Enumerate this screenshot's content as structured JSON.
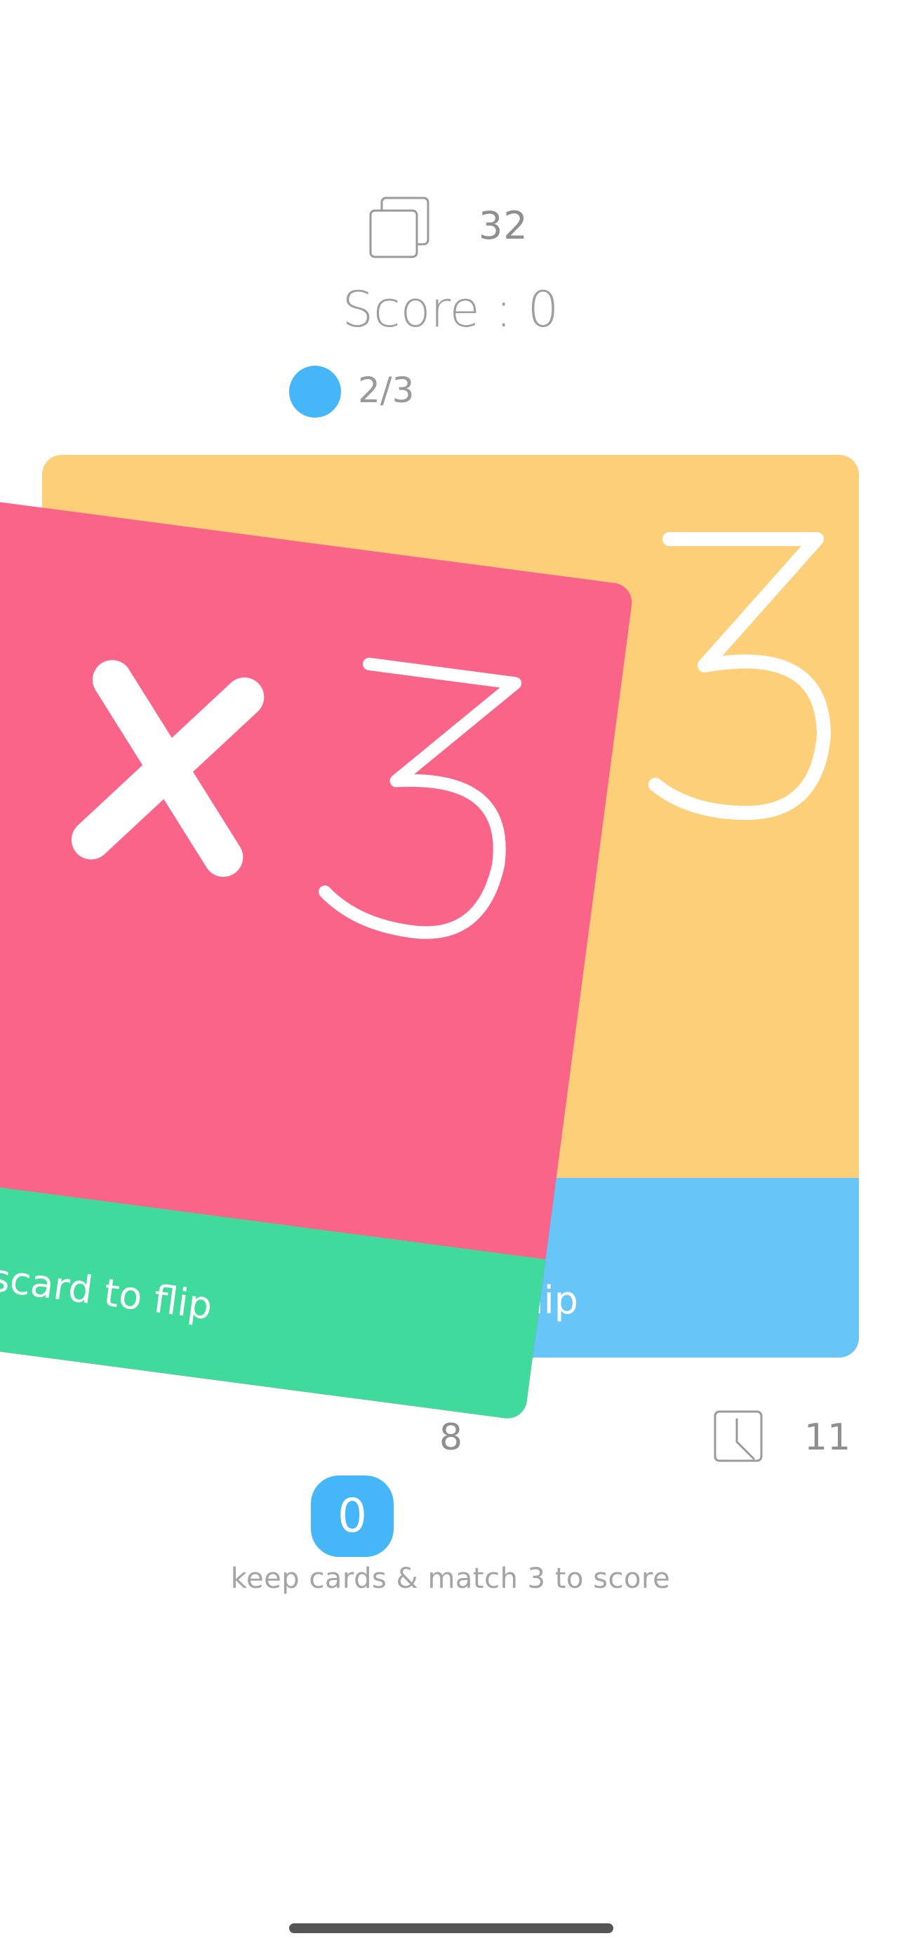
{
  "header": {
    "deck_count": "32",
    "score_label": "Score : 0",
    "progress": "2/3",
    "progress_color": "#45b6f8"
  },
  "cards": {
    "back": {
      "value": "3",
      "footer_label": "o flip",
      "colors": {
        "top": "#fdcf78",
        "footer": "#67c5f8"
      }
    },
    "front": {
      "value": "×3",
      "footer_label": "discard to flip",
      "colors": {
        "top": "#fb6489",
        "footer": "#40da9c"
      }
    }
  },
  "stats": {
    "pile_count": "8",
    "time_count": "11"
  },
  "hand": {
    "kept_count": "0",
    "hint": "keep cards & match 3 to score"
  },
  "icons": {
    "deck": "deck-icon",
    "clock": "clock-icon"
  }
}
